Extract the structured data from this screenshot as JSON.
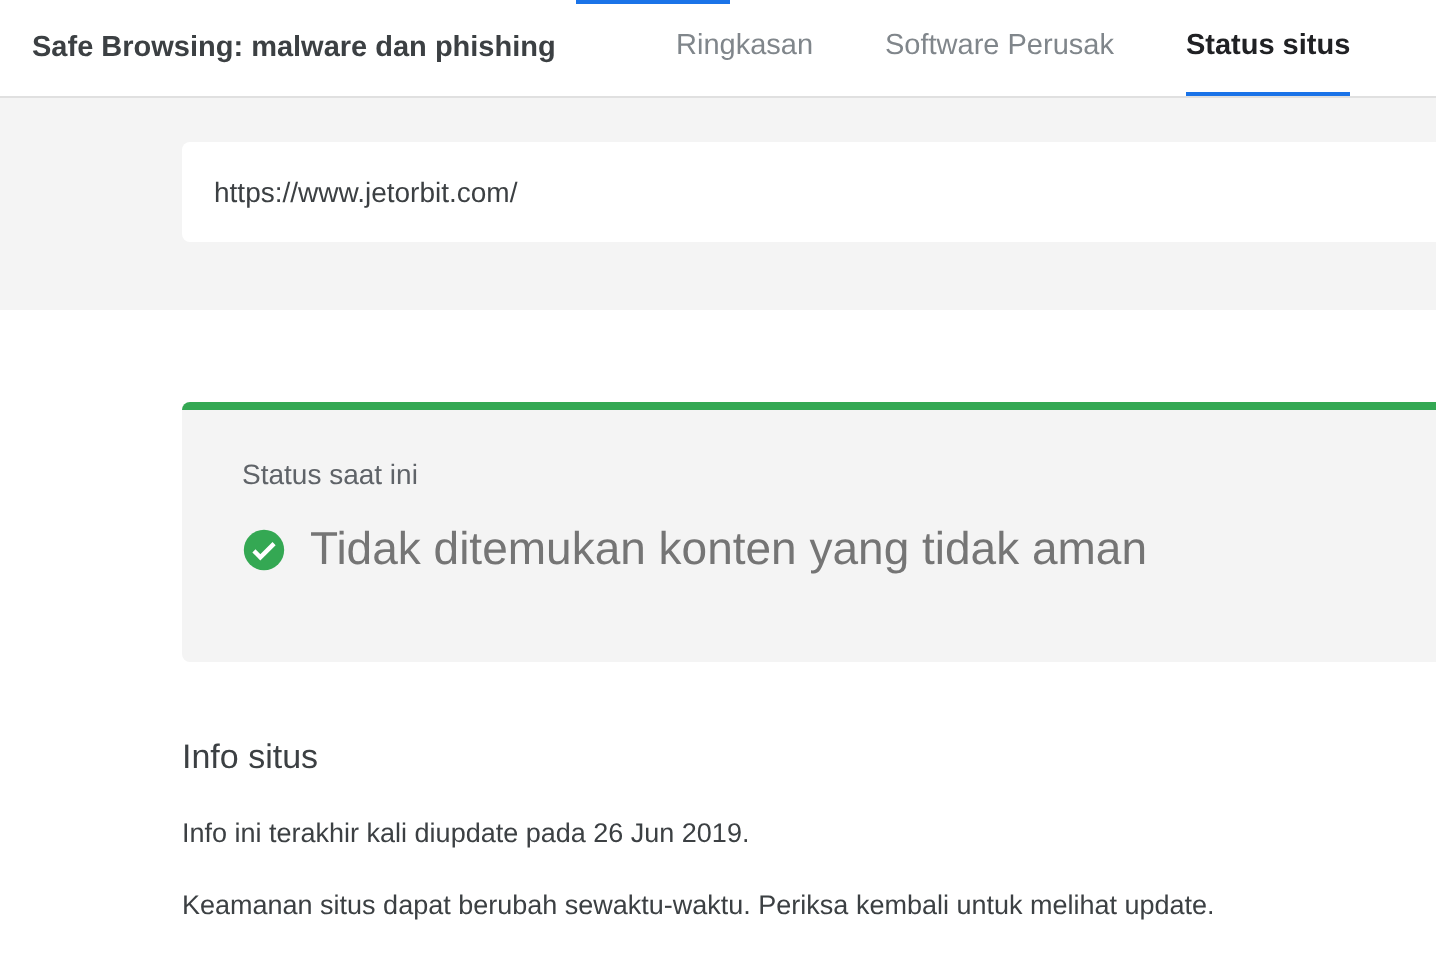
{
  "header": {
    "title": "Safe Browsing: malware dan phishing"
  },
  "tabs": [
    {
      "label": "Ringkasan",
      "selected": false
    },
    {
      "label": "Software Perusak",
      "selected": false
    },
    {
      "label": "Status situs",
      "selected": true
    }
  ],
  "search": {
    "value": "https://www.jetorbit.com/"
  },
  "status": {
    "label": "Status saat ini",
    "kind": "safe",
    "message": "Tidak ditemukan konten yang tidak aman"
  },
  "site_info": {
    "heading": "Info situs",
    "paragraphs": [
      "Info ini terakhir kali diupdate pada 26 Jun 2019.",
      "Keamanan situs dapat berubah sewaktu-waktu. Periksa kembali untuk melihat update."
    ]
  }
}
